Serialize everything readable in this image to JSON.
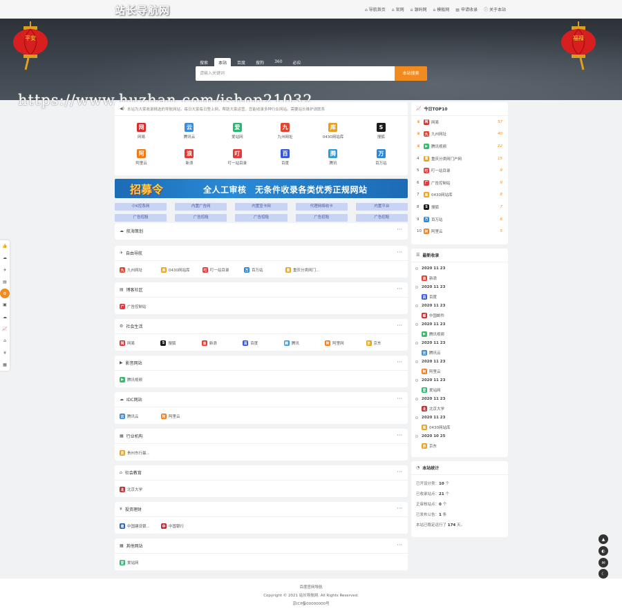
{
  "header": {
    "logo": "站长导航网",
    "nav": [
      {
        "icon": "home-icon",
        "label": "导航首页"
      },
      {
        "icon": "home-icon",
        "label": "官网"
      },
      {
        "icon": "home-icon",
        "label": "源码网"
      },
      {
        "icon": "home-icon",
        "label": "模板网"
      },
      {
        "icon": "doc-icon",
        "label": "申请收录"
      },
      {
        "icon": "info-icon",
        "label": "关于本站"
      }
    ]
  },
  "search": {
    "tabs": [
      "搜索",
      "本站",
      "百度",
      "搜狗",
      "360",
      "必应"
    ],
    "active_tab": "本站",
    "placeholder": "请输入关键词",
    "button": "本站搜索"
  },
  "lanterns": {
    "left": "平安",
    "right": "福禄"
  },
  "watermark": "https://www.huzhan.com/ishop21032",
  "notice": "本站为大家收录精选的导航网站，每日大家每日登上网，帮助大家运营，您能收录多种行业网站。需要站长维护请联系",
  "hot_sites": [
    {
      "name": "网易",
      "icon": "网",
      "color": "#d92b2b"
    },
    {
      "name": "腾讯云",
      "icon": "云",
      "color": "#3c8cd9"
    },
    {
      "name": "爱站网",
      "icon": "爱",
      "color": "#2bb673"
    },
    {
      "name": "九州网址",
      "icon": "九",
      "color": "#e0452f"
    },
    {
      "name": "0430网站库",
      "icon": "库",
      "color": "#e6a21f"
    },
    {
      "name": "搜狐",
      "icon": "S",
      "color": "#1b1b1b"
    },
    {
      "name": "阿里云",
      "icon": "阿",
      "color": "#f07a17"
    },
    {
      "name": "新浪",
      "icon": "浪",
      "color": "#e03a2f"
    },
    {
      "name": "叮一站目录",
      "icon": "叮",
      "color": "#e23b3b"
    },
    {
      "name": "百度",
      "icon": "百",
      "color": "#3657d9"
    },
    {
      "name": "腾讯",
      "icon": "腾",
      "color": "#2f9ae0"
    },
    {
      "name": "百万站",
      "icon": "万",
      "color": "#2d86d6"
    }
  ],
  "banner": {
    "title": "招募令",
    "text": "全人工审核　无条件收录各类优秀正规网站"
  },
  "ads_row1": [
    "小K控系网",
    "内置广告网",
    "内置宣卡网",
    "代理网络收卡",
    "内置平台"
  ],
  "ads_row2": [
    "广告招租",
    "广告招租",
    "广告招租",
    "广告招租",
    "广告招租"
  ],
  "sidebar_icons": [
    "thumb-icon",
    "cloud-icon",
    "plane-icon",
    "doc-icon",
    "tools-icon",
    "box-icon",
    "cloud-icon",
    "chart-icon",
    "grad-icon",
    "yen-icon",
    "grid-icon"
  ],
  "sections": [
    {
      "title": "航海策划",
      "icon": "☁",
      "links": []
    },
    {
      "title": "自由导航",
      "icon": "✈",
      "links": [
        {
          "name": "九州网址",
          "icon": "九",
          "color": "#e0452f"
        },
        {
          "name": "0430网站库",
          "icon": "库",
          "color": "#e6a21f"
        },
        {
          "name": "叮一站目录",
          "icon": "叮",
          "color": "#e23b3b"
        },
        {
          "name": "百万站",
          "icon": "万",
          "color": "#2d86d6"
        },
        {
          "name": "重庆分类网门...",
          "icon": "重",
          "color": "#e6a21f"
        }
      ]
    },
    {
      "title": "博客社区",
      "icon": "▤",
      "links": [
        {
          "name": "广告控制站",
          "icon": "广",
          "color": "#e23b3b"
        }
      ]
    },
    {
      "title": "社会生活",
      "icon": "⚙",
      "links": [
        {
          "name": "网易",
          "icon": "网",
          "color": "#d92b2b"
        },
        {
          "name": "搜狐",
          "icon": "S",
          "color": "#1b1b1b"
        },
        {
          "name": "新浪",
          "icon": "浪",
          "color": "#e03a2f"
        },
        {
          "name": "百度",
          "icon": "百",
          "color": "#3657d9"
        },
        {
          "name": "腾讯",
          "icon": "腾",
          "color": "#2f9ae0"
        },
        {
          "name": "阿里网",
          "icon": "阿",
          "color": "#f07a17"
        },
        {
          "name": "京东",
          "icon": "京",
          "color": "#e6a21f"
        }
      ]
    },
    {
      "title": "影音网站",
      "icon": "▶",
      "links": [
        {
          "name": "腾讯视频",
          "icon": "▶",
          "color": "#3cb96b"
        }
      ]
    },
    {
      "title": "IDC网站",
      "icon": "☁",
      "links": [
        {
          "name": "腾讯云",
          "icon": "云",
          "color": "#3c8cd9"
        },
        {
          "name": "阿里云",
          "icon": "阿",
          "color": "#f07a17"
        }
      ]
    },
    {
      "title": "行业机构",
      "icon": "▦",
      "links": [
        {
          "name": "贵州东行最...",
          "icon": "贵",
          "color": "#e6a21f"
        }
      ]
    },
    {
      "title": "社会教育",
      "icon": "⌂",
      "links": [
        {
          "name": "北京大学",
          "icon": "北",
          "color": "#b8312f"
        }
      ]
    },
    {
      "title": "投资理财",
      "icon": "¥",
      "links": [
        {
          "name": "中国建设银...",
          "icon": "建",
          "color": "#1f5fb3"
        },
        {
          "name": "中国银行",
          "icon": "中",
          "color": "#c3282d"
        }
      ]
    },
    {
      "title": "其他网站",
      "icon": "▦",
      "links": [
        {
          "name": "爱站网",
          "icon": "爱",
          "color": "#2bb673"
        }
      ]
    }
  ],
  "top10": {
    "title": "今日TOP10",
    "items": [
      {
        "rank": "1",
        "name": "网易",
        "count": "57",
        "icon": "网",
        "color": "#d92b2b",
        "crown": true
      },
      {
        "rank": "2",
        "name": "九州网址",
        "count": "40",
        "icon": "九",
        "color": "#e0452f",
        "crown": true
      },
      {
        "rank": "3",
        "name": "腾讯视频",
        "count": "22",
        "icon": "▶",
        "color": "#3cb96b",
        "crown": true
      },
      {
        "rank": "4",
        "name": "重庆分类网门户网",
        "count": "15",
        "icon": "重",
        "color": "#e6a21f",
        "crown": false
      },
      {
        "rank": "5",
        "name": "叮一站目录",
        "count": "9",
        "icon": "叮",
        "color": "#e23b3b",
        "crown": false
      },
      {
        "rank": "6",
        "name": "广告控制站",
        "count": "9",
        "icon": "广",
        "color": "#e23b3b",
        "crown": false
      },
      {
        "rank": "7",
        "name": "0430网站库",
        "count": "8",
        "icon": "库",
        "color": "#e6a21f",
        "crown": false
      },
      {
        "rank": "8",
        "name": "搜狐",
        "count": "7",
        "icon": "S",
        "color": "#1b1b1b",
        "crown": false
      },
      {
        "rank": "9",
        "name": "百万站",
        "count": "6",
        "icon": "万",
        "color": "#2d86d6",
        "crown": false
      },
      {
        "rank": "10",
        "name": "阿里云",
        "count": "5",
        "icon": "阿",
        "color": "#f07a17",
        "crown": false
      }
    ]
  },
  "recent": {
    "title": "最新收录",
    "items": [
      {
        "date": "2020 11 23",
        "name": "新浪",
        "icon": "浪",
        "color": "#e03a2f"
      },
      {
        "date": "2020 11 23",
        "name": "百度",
        "icon": "百",
        "color": "#3657d9"
      },
      {
        "date": "2020 11 23",
        "name": "中国邮件",
        "icon": "邮",
        "color": "#c3282d"
      },
      {
        "date": "2020 11 23",
        "name": "腾讯视频",
        "icon": "▶",
        "color": "#3cb96b"
      },
      {
        "date": "2020 11 23",
        "name": "腾讯云",
        "icon": "云",
        "color": "#3c8cd9"
      },
      {
        "date": "2020 11 23",
        "name": "阿里云",
        "icon": "阿",
        "color": "#f07a17"
      },
      {
        "date": "2020 11 23",
        "name": "爱站网",
        "icon": "爱",
        "color": "#2bb673"
      },
      {
        "date": "2020 11 23",
        "name": "北京大学",
        "icon": "北",
        "color": "#b8312f"
      },
      {
        "date": "2020 11 23",
        "name": "0430网站库",
        "icon": "库",
        "color": "#e6a21f"
      },
      {
        "date": "2020 10 25",
        "name": "京东",
        "icon": "京",
        "color": "#e6a21f"
      }
    ]
  },
  "stats": {
    "title": "本站统计",
    "rows": [
      {
        "label": "已开设分类：",
        "value": "10",
        "unit": " 个"
      },
      {
        "label": "已收录站点：",
        "value": "21",
        "unit": " 个"
      },
      {
        "label": "正审核站点：",
        "value": "0",
        "unit": " 个"
      },
      {
        "label": "已发布公告：",
        "value": "1",
        "unit": " 条"
      },
      {
        "label": "本站已稳定运行了 ",
        "value": "174",
        "unit": " 天。"
      }
    ]
  },
  "footer": {
    "line1": "百度官网导航",
    "line2": "Copyright © 2021 站长导航网. All Rights Reserved.",
    "line3": "京ICP备00000000号"
  },
  "colors": {
    "accent": "#f28b1f",
    "ad_bg": "#c9d4f5"
  }
}
